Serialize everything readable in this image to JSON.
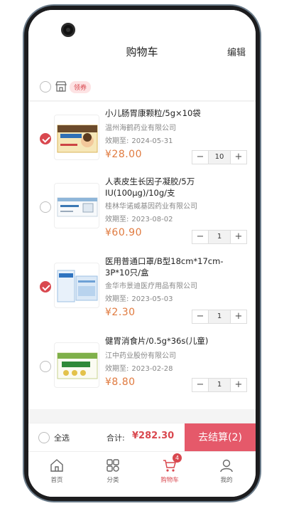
{
  "header": {
    "title": "购物车",
    "edit_label": "编辑"
  },
  "store": {
    "coupon_label": "领券",
    "icon": "store-icon"
  },
  "items": [
    {
      "name": "小儿肠胃康颗粒/5g×10袋",
      "maker": "温州海鹤药业有限公司",
      "expiry_label": "效期至:",
      "expiry": "2024-05-31",
      "price": "¥28.00",
      "qty": "10",
      "checked": true
    },
    {
      "name": "人表皮生长因子凝胶/5万IU(100μg)/10g/支",
      "maker": "桂林华诺威基因药业有限公司",
      "expiry_label": "效期至:",
      "expiry": "2023-08-02",
      "price": "¥60.90",
      "qty": "1",
      "checked": false
    },
    {
      "name": "医用普通口罩/B型18cm*17cm-3P*10只/盒",
      "maker": "金华市景迪医疗用品有限公司",
      "expiry_label": "效期至:",
      "expiry": "2023-05-03",
      "price": "¥2.30",
      "qty": "1",
      "checked": true
    },
    {
      "name": "健胃消食片/0.5g*36s(儿童)",
      "maker": "江中药业股份有限公司",
      "expiry_label": "效期至:",
      "expiry": "2023-02-28",
      "price": "¥8.80",
      "qty": "1",
      "checked": false
    }
  ],
  "stepper": {
    "minus": "−",
    "plus": "+"
  },
  "checkout": {
    "select_all": "全选",
    "total_label": "合计:",
    "total_value": "¥282.30",
    "settle_label": "去结算(2)"
  },
  "tabs": [
    {
      "label": "首页",
      "icon": "home-icon"
    },
    {
      "label": "分类",
      "icon": "category-icon"
    },
    {
      "label": "购物车",
      "icon": "cart-icon",
      "badge": "4",
      "active": true
    },
    {
      "label": "我的",
      "icon": "profile-icon"
    }
  ],
  "colors": {
    "accent": "#d9484f",
    "price": "#e07a3f",
    "settle": "#e5596a"
  }
}
